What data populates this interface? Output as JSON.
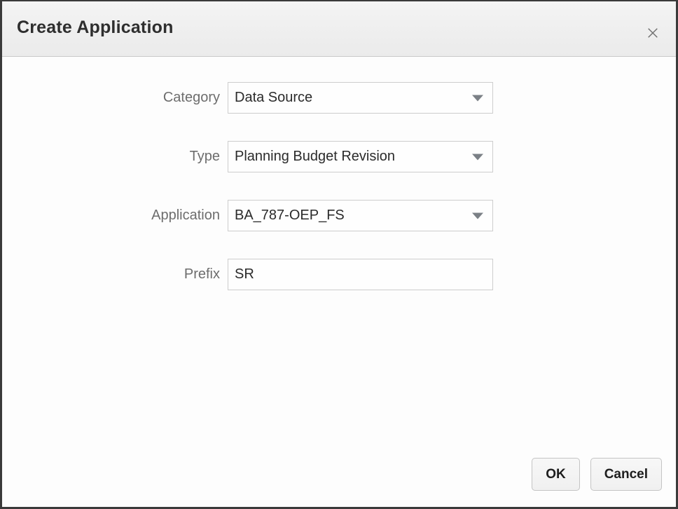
{
  "dialog": {
    "title": "Create Application",
    "close_icon": "close-icon"
  },
  "form": {
    "rows": [
      {
        "label": "Category",
        "value": "Data Source",
        "control": "dropdown",
        "icon": "chevron-down-icon"
      },
      {
        "label": "Type",
        "value": "Planning Budget Revision",
        "control": "dropdown",
        "icon": "chevron-down-icon"
      },
      {
        "label": "Application",
        "value": "BA_787-OEP_FS",
        "control": "dropdown",
        "icon": "chevron-down-icon"
      },
      {
        "label": "Prefix",
        "value": "SR",
        "control": "text",
        "placeholder": ""
      }
    ]
  },
  "footer": {
    "ok_label": "OK",
    "cancel_label": "Cancel"
  },
  "colors": {
    "titlebar_bg": "#eeeeee",
    "body_bg": "#fdfdfd",
    "border": "#3a3a3a",
    "label_text": "#6d6d6d",
    "value_text": "#2b2b2b",
    "title_text": "#2e2e2e",
    "field_border": "#cdcdcd",
    "arrow": "#7b8086",
    "button_bg": "#f2f2f2",
    "button_border": "#c4c4c4"
  }
}
